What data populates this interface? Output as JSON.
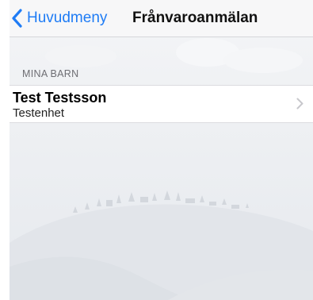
{
  "navbar": {
    "back_label": "Huvudmeny",
    "title": "Frånvaroanmälan"
  },
  "section": {
    "header": "MINA BARN"
  },
  "children": [
    {
      "name": "Test Testsson",
      "unit": "Testenhet"
    }
  ],
  "colors": {
    "accent": "#1f7cf5",
    "background": "#eef0f3"
  }
}
